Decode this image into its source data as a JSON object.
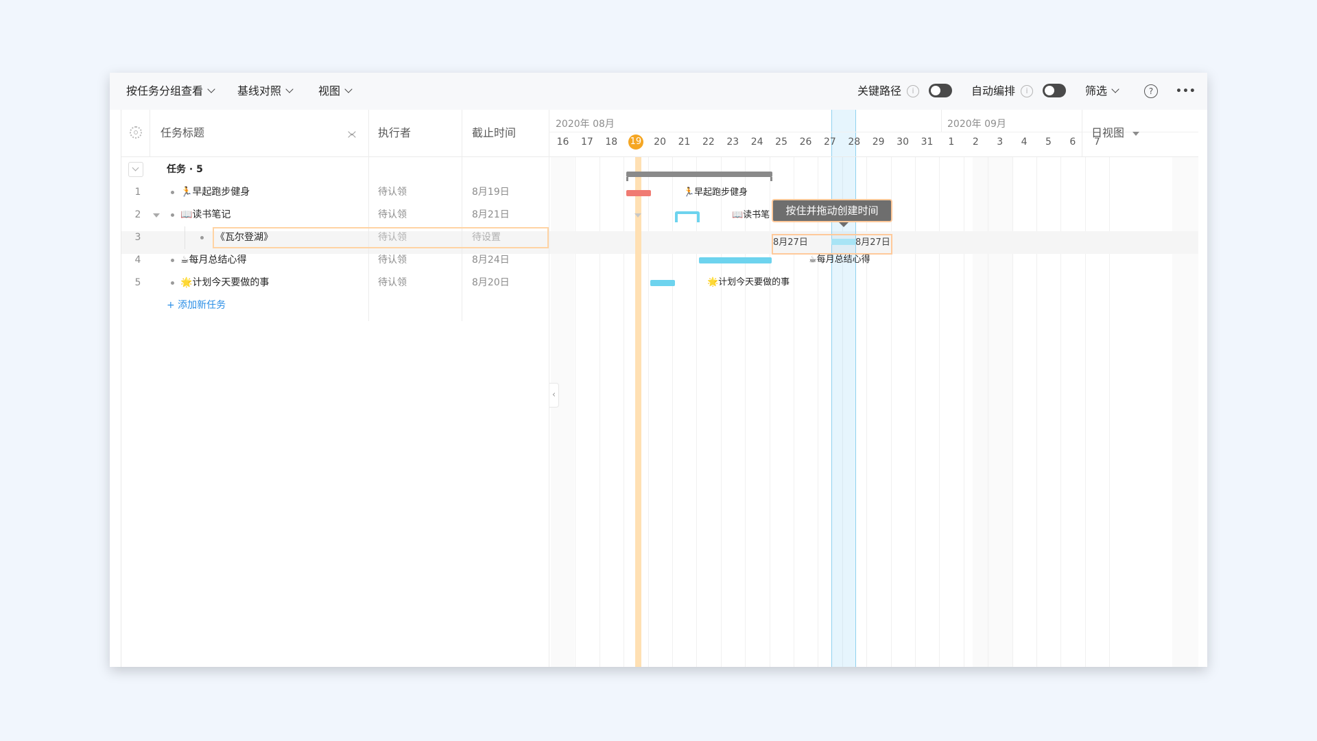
{
  "toolbar": {
    "group_view": "按任务分组查看",
    "baseline": "基线对照",
    "view": "视图",
    "critical_path": "关键路径",
    "auto_schedule": "自动编排",
    "info_glyph": "i",
    "filter": "筛选",
    "help_glyph": "?",
    "more_glyph": "•••"
  },
  "columns": {
    "title": "任务标题",
    "assignee": "执行者",
    "deadline": "截止时间"
  },
  "timeline": {
    "month_aug": "2020年 08月",
    "month_sep": "2020年 09月",
    "days": [
      "16",
      "17",
      "18",
      "19",
      "20",
      "21",
      "22",
      "23",
      "24",
      "25",
      "26",
      "27",
      "28",
      "29",
      "30",
      "31",
      "1",
      "2",
      "3",
      "4",
      "5",
      "6",
      "7"
    ],
    "today": "19",
    "view_mode": "日视图"
  },
  "group": {
    "label": "任务 · 5"
  },
  "tasks": [
    {
      "num": "1",
      "title": "🏃早起跑步健身",
      "assignee": "待认领",
      "deadline": "8月19日",
      "bar_label": "🏃早起跑步健身"
    },
    {
      "num": "2",
      "title": "📖读书笔记",
      "assignee": "待认领",
      "deadline": "8月21日",
      "bar_label": "📖读书笔"
    },
    {
      "num": "3",
      "title": "《瓦尔登湖》",
      "assignee": "待认领",
      "deadline": "待设置"
    },
    {
      "num": "4",
      "title": "☕每月总结心得",
      "assignee": "待认领",
      "deadline": "8月24日",
      "bar_label": "☕每月总结心得"
    },
    {
      "num": "5",
      "title": "🌟计划今天要做的事",
      "assignee": "待认领",
      "deadline": "8月20日",
      "bar_label": "🌟计划今天要做的事"
    }
  ],
  "add_task": "+ 添加新任务",
  "drag_hint": {
    "tooltip": "按住并拖动创建时间",
    "start": "8月27日",
    "end": "8月27日"
  },
  "colors": {
    "today": "#f5a623",
    "bar_red": "#f07b72",
    "bar_blue": "#6dd3ee",
    "selection": "#ffd9a8"
  }
}
